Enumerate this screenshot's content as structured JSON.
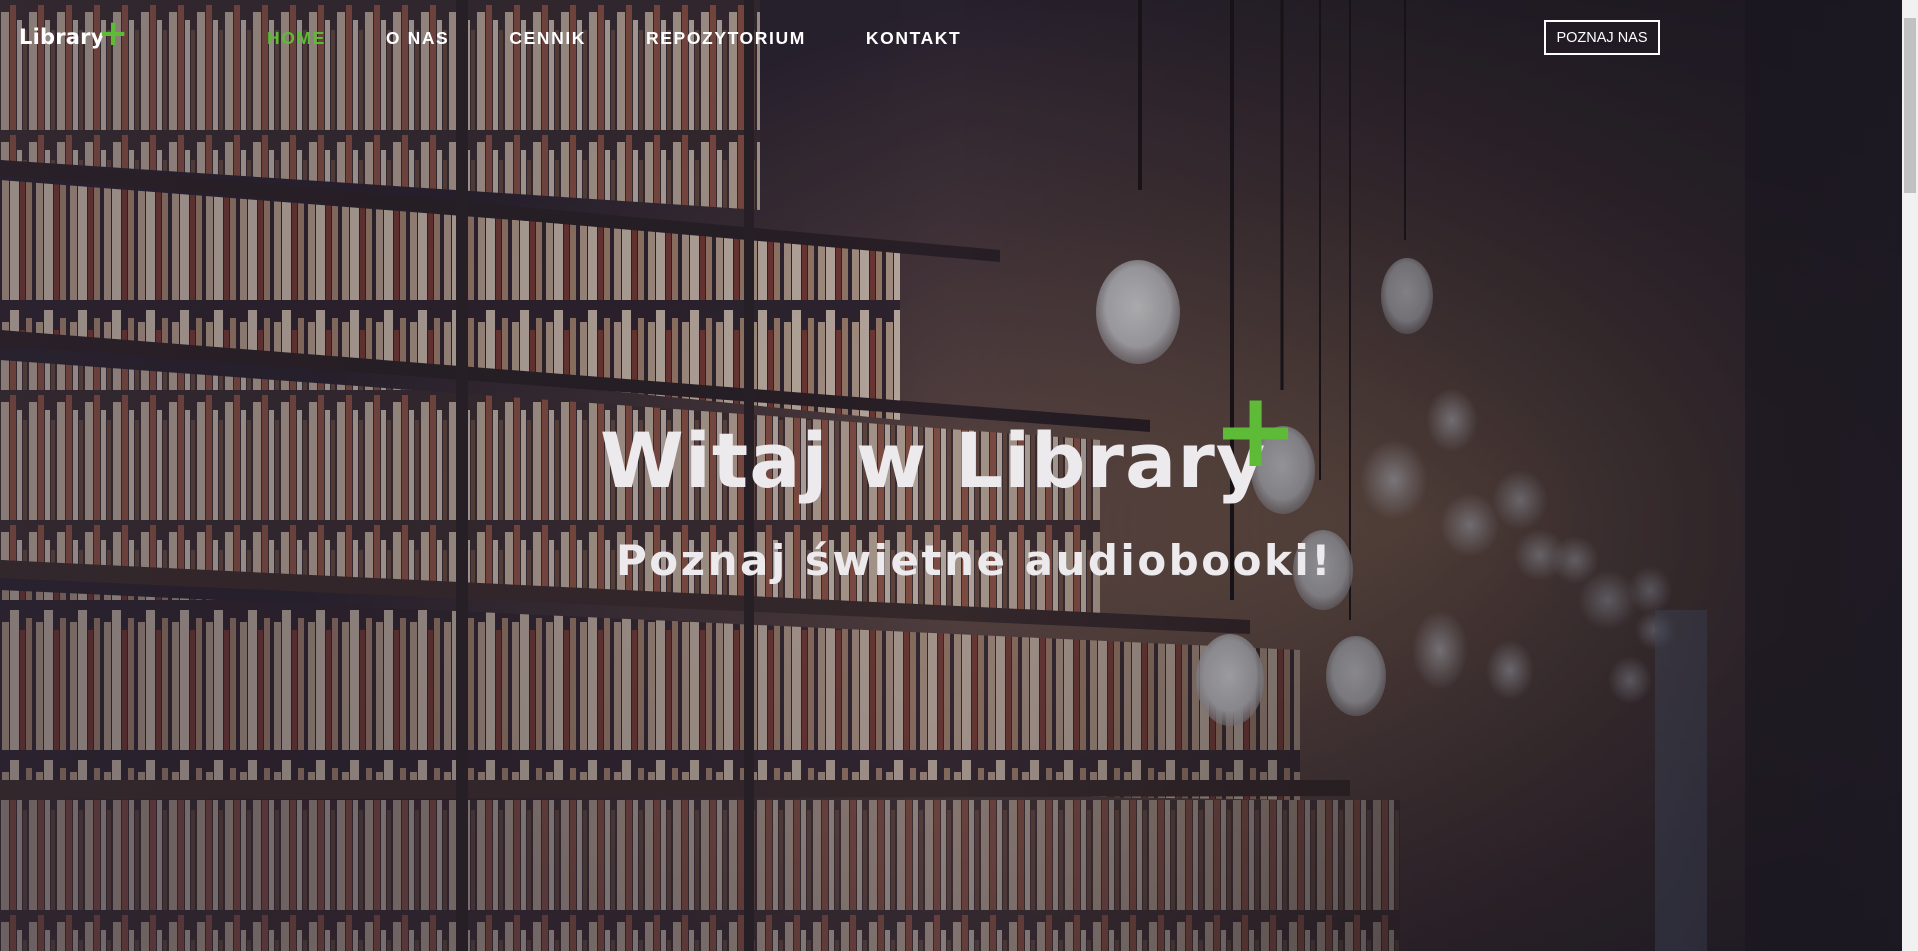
{
  "nav": {
    "logo_text": "Library",
    "logo_plus": "+",
    "items": [
      {
        "label": "HOME",
        "active": true
      },
      {
        "label": "O NAS",
        "active": false
      },
      {
        "label": "CENNIK",
        "active": false
      },
      {
        "label": "REPOZYTORIUM",
        "active": false
      },
      {
        "label": "KONTAKT",
        "active": false
      }
    ],
    "cta_label": "POZNAJ NAS"
  },
  "hero": {
    "title": "Witaj w Library",
    "title_plus": "+",
    "subtitle": "Poznaj świetne audiobooki!"
  },
  "colors": {
    "accent": "#5dbb37",
    "text": "#ffffff"
  }
}
